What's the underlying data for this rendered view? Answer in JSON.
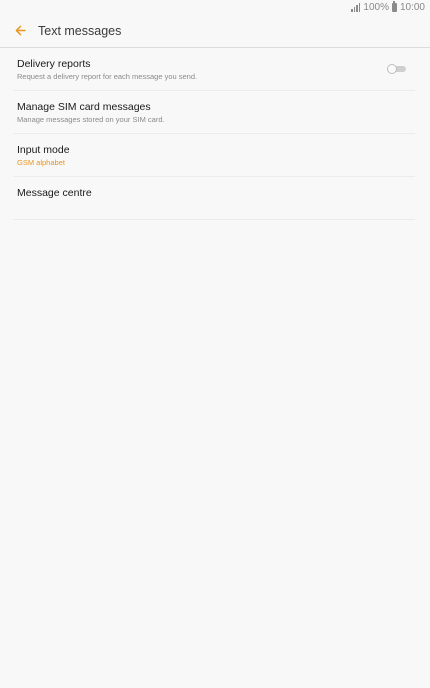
{
  "status_bar": {
    "battery_percent": "100%",
    "time": "10:00",
    "icons": [
      "signal-icon",
      "battery-icon"
    ]
  },
  "header": {
    "title": "Text messages",
    "back_icon": "arrow-left-icon",
    "accent_color": "#e7951f"
  },
  "settings": {
    "items": [
      {
        "title": "Delivery reports",
        "summary": "Request a delivery report for each message you send.",
        "toggle_on": false
      },
      {
        "title": "Manage SIM card messages",
        "summary": "Manage messages stored on your SIM card."
      },
      {
        "title": "Input mode",
        "summary": "GSM alphabet"
      },
      {
        "title": "Message centre"
      }
    ]
  }
}
